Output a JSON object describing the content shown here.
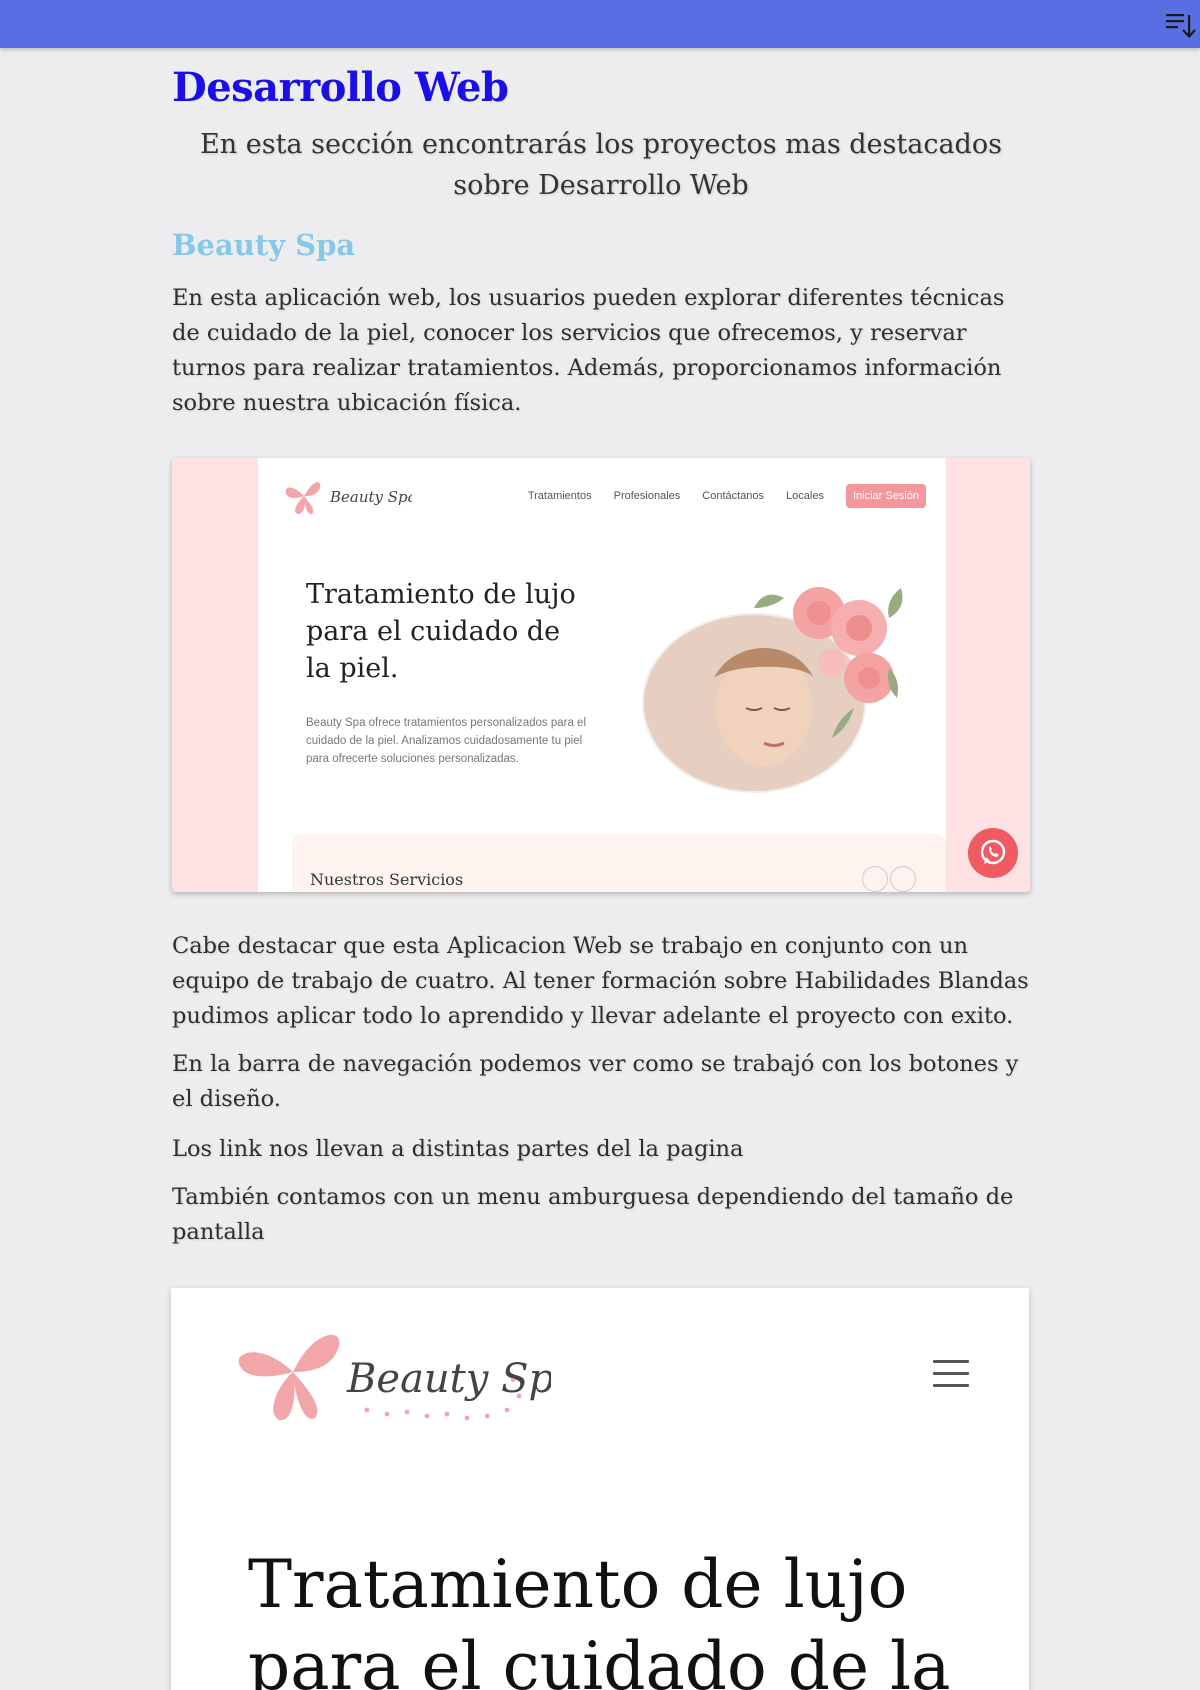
{
  "header": {
    "menu_icon": "sort-list-icon",
    "color": "#5a6ee3"
  },
  "page": {
    "title": "Desarrollo Web",
    "intro": "En esta sección encontrarás los proyectos mas destacados sobre Desarrollo Web"
  },
  "project": {
    "title": "Beauty Spa",
    "description": "En esta aplicación web, los usuarios pueden explorar diferentes técnicas de cuidado de la piel, conocer los servicios que ofrecemos, y reservar turnos para realizar tratamientos. Además, proporcionamos información sobre nuestra ubicación física.",
    "paragraphs": [
      "Cabe destacar que esta Aplicacion Web se trabajo en conjunto con un equipo de trabajo de cuatro. Al tener formación sobre Habilidades Blandas pudimos aplicar todo lo aprendido y llevar adelante el proyecto con exito.",
      "En la barra de navegación podemos ver como se trabajó con los botones y el diseño.",
      "Los link nos llevan a distintas partes del la pagina",
      "También contamos con un menu amburguesa dependiendo del tamaño de pantalla"
    ]
  },
  "screenshot_desktop": {
    "logo_text": "Beauty Spa",
    "nav": [
      "Tratamientos",
      "Profesionales",
      "Contáctanos",
      "Locales"
    ],
    "login_button": "Iniciar Sesión",
    "hero_title": "Tratamiento de lujo para el cuidado de la piel.",
    "hero_text": "Beauty Spa ofrece tratamientos personalizados para el cuidado de la piel. Analizamos cuidadosamente tu piel para ofrecerte soluciones personalizadas.",
    "services_title": "Nuestros Servicios",
    "whatsapp_icon": "whatsapp-icon",
    "brand_pink": "#f4979c"
  },
  "screenshot_mobile": {
    "logo_text": "Beauty Spa",
    "hero_title": "Tratamiento de lujo para el cuidado de la",
    "hamburger_icon": "hamburger-menu-icon"
  }
}
